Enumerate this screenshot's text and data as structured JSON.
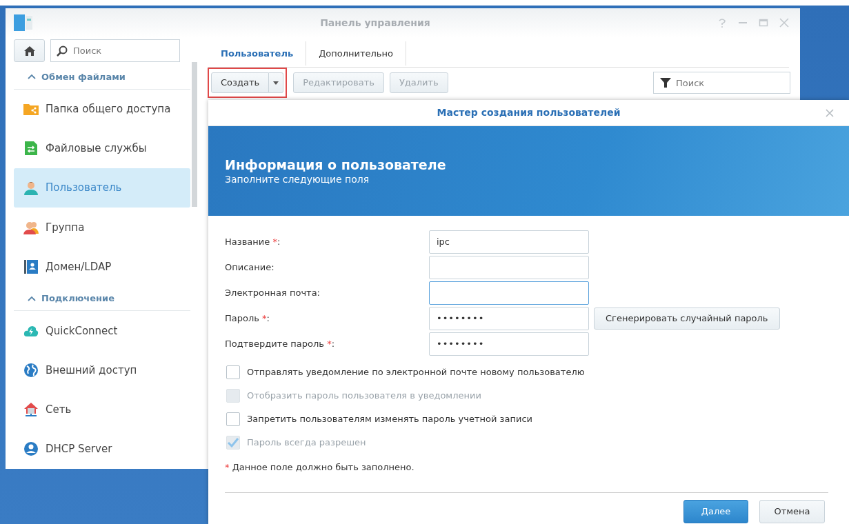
{
  "window": {
    "title": "Панель управления"
  },
  "sidebar": {
    "search": {
      "placeholder": "Поиск"
    },
    "sections": [
      {
        "title": "Обмен файлами",
        "expanded": true,
        "items": [
          {
            "label": "Папка общего доступа",
            "selected": false
          },
          {
            "label": "Файловые службы",
            "selected": false
          },
          {
            "label": "Пользователь",
            "selected": true
          },
          {
            "label": "Группа",
            "selected": false
          },
          {
            "label": "Домен/LDAP",
            "selected": false
          }
        ]
      },
      {
        "title": "Подключение",
        "expanded": true,
        "items": [
          {
            "label": "QuickConnect",
            "selected": false
          },
          {
            "label": "Внешний доступ",
            "selected": false
          },
          {
            "label": "Сеть",
            "selected": false
          },
          {
            "label": "DHCP Server",
            "selected": false
          }
        ]
      }
    ]
  },
  "tabs": [
    {
      "label": "Пользователь",
      "selected": true
    },
    {
      "label": "Дополнительно",
      "selected": false
    }
  ],
  "toolbar": {
    "create": {
      "label": "Создать",
      "highlighted": true
    },
    "buttons": [
      "Редактировать",
      "Удалить"
    ],
    "filter": {
      "placeholder": "Поиск"
    }
  },
  "dialog": {
    "title": "Мастер создания пользователей",
    "banner": {
      "title": "Информация о пользователе",
      "subtitle": "Заполните следующие поля"
    },
    "fields": [
      {
        "label": "Название",
        "required_mark": "*",
        "label_end": ":",
        "value": "ipc",
        "focused": false
      },
      {
        "label": "Описание:",
        "focused": false
      },
      {
        "label": "Электронная почта:",
        "focused": true
      },
      {
        "label": "Пароль",
        "required_mark": "*",
        "label_end": ":",
        "value": "••••••••",
        "focused": false,
        "button": "Сгенерировать случайный пароль"
      },
      {
        "label": "Подтвердите пароль",
        "required_mark": "*",
        "label_end": ":",
        "value": "••••••••",
        "focused": false
      }
    ],
    "checkboxes": [
      {
        "label": "Отправлять уведомление по электронной почте новому пользователю",
        "checked": false,
        "disabled": false
      },
      {
        "label": "Отобразить пароль пользователя в уведомлении",
        "checked": false,
        "disabled": true
      },
      {
        "label": "Запретить пользователям изменять пароль учетной записи",
        "checked": false,
        "disabled": false
      },
      {
        "label": "Пароль всегда разрешен",
        "checked": true,
        "disabled": true
      }
    ],
    "note": {
      "mark": "*",
      "text": "Данное поле должно быть заполнено."
    },
    "buttons": [
      {
        "label": "Далее",
        "primary": true
      },
      {
        "label": "Отмена",
        "primary": false
      }
    ]
  }
}
